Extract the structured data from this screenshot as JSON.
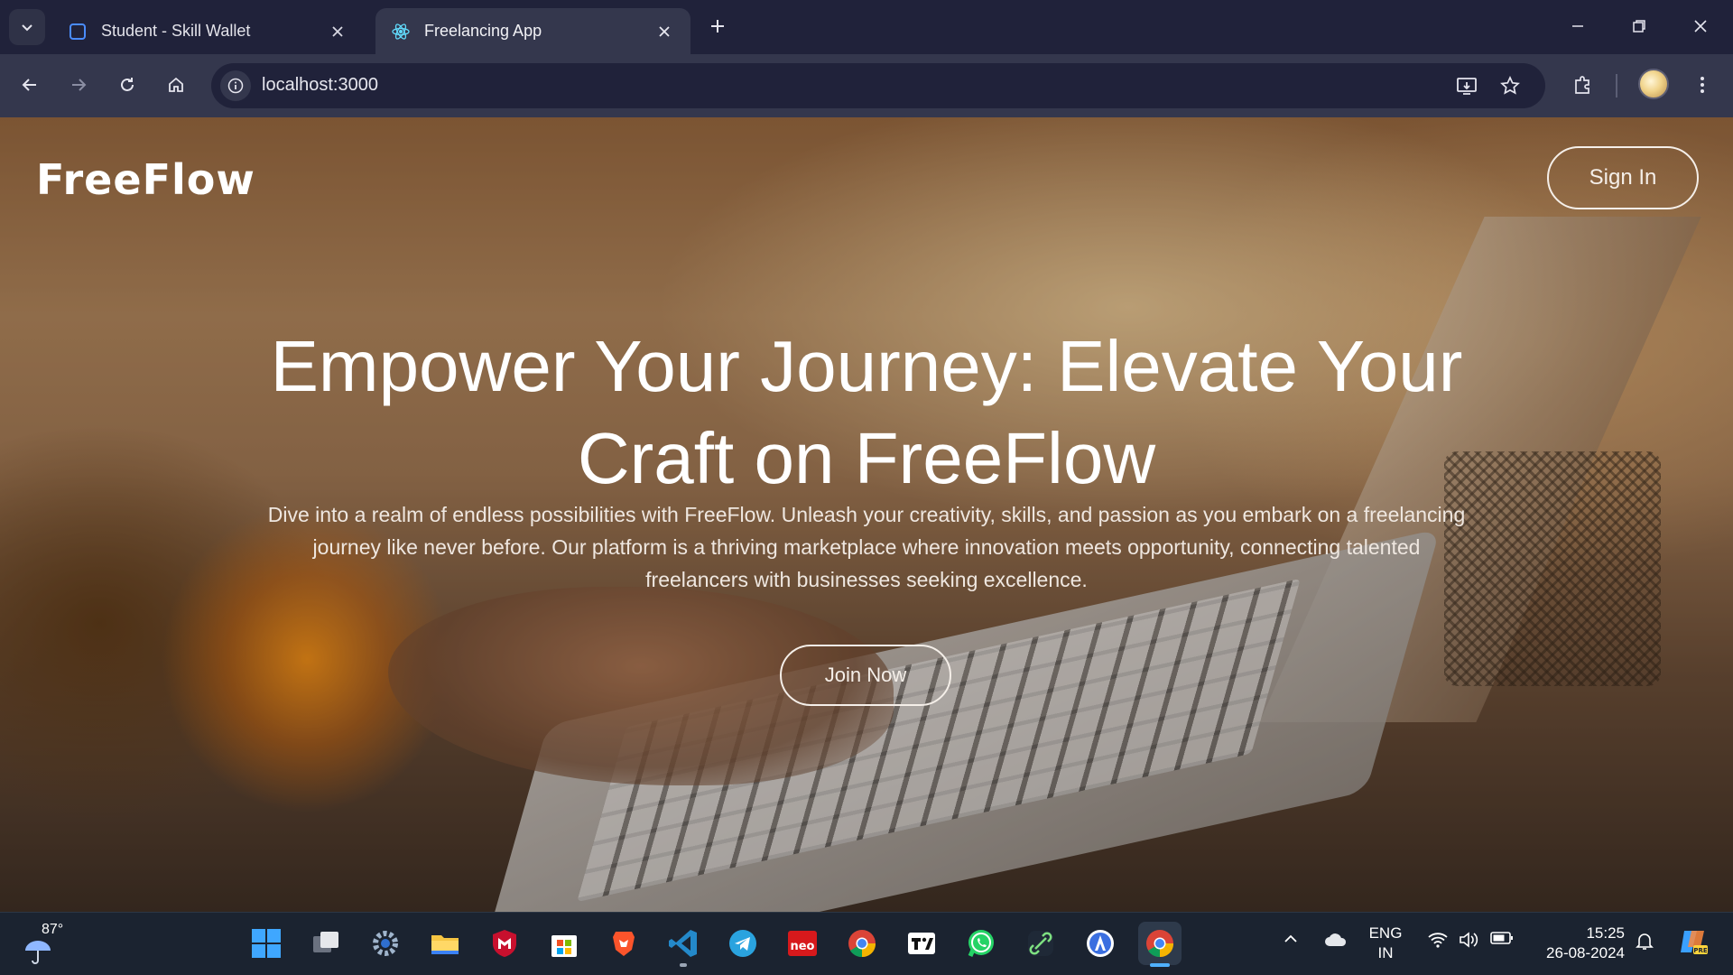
{
  "browser": {
    "tabs": [
      {
        "title": "Student - Skill Wallet",
        "icon": "page-icon",
        "active": false
      },
      {
        "title": "Freelancing App",
        "icon": "react-icon",
        "active": true
      }
    ],
    "url": "localhost:3000"
  },
  "page": {
    "logo": "FreeFlow",
    "sign_in_label": "Sign In",
    "hero_title": "Empower Your Journey: Elevate Your Craft on FreeFlow",
    "hero_text": "Dive into a realm of endless possibilities with FreeFlow. Unleash your creativity, skills, and passion as you embark on a freelancing journey like never before. Our platform is a thriving marketplace where innovation meets opportunity, connecting talented freelancers with businesses seeking excellence.",
    "join_label": "Join Now"
  },
  "taskbar": {
    "weather_temp": "87°",
    "apps": [
      "start",
      "task-view",
      "settings",
      "file-explorer",
      "mcafee",
      "microsoft-store",
      "brave",
      "vscode",
      "telegram",
      "neo",
      "chrome",
      "tradingview",
      "whatsapp",
      "app-linker",
      "app-assistant",
      "chrome-active"
    ],
    "language_line1": "ENG",
    "language_line2": "IN",
    "time": "15:25",
    "date": "26-08-2024"
  },
  "colors": {
    "chrome_dark": "#20223a",
    "chrome_toolbar": "#34374d",
    "taskbar": "#1b2330",
    "hero_text": "#ffffff"
  }
}
